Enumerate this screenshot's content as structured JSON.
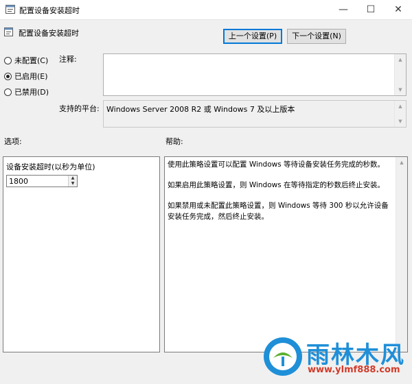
{
  "window": {
    "title": "配置设备安装超时",
    "controls": {
      "minimize": "—",
      "maximize": "☐",
      "close": "✕"
    }
  },
  "policy": {
    "name": "配置设备安装超时",
    "prev_label": "上一个设置(P)",
    "next_label": "下一个设置(N)"
  },
  "state": {
    "options": [
      {
        "label": "未配置(C)",
        "checked": false
      },
      {
        "label": "已启用(E)",
        "checked": true
      },
      {
        "label": "已禁用(D)",
        "checked": false
      }
    ]
  },
  "comment": {
    "label": "注释:",
    "value": ""
  },
  "platform": {
    "label": "支持的平台:",
    "value": "Windows Server 2008 R2 或 Windows 7 及以上版本"
  },
  "options_section": {
    "label": "选项:",
    "timeout_label": "设备安装超时(以秒为单位)",
    "timeout_value": "1800"
  },
  "help_section": {
    "label": "帮助:",
    "paragraphs": [
      "使用此策略设置可以配置 Windows 等待设备安装任务完成的秒数。",
      "如果启用此策略设置，则 Windows 在等待指定的秒数后终止安装。",
      "如果禁用或未配置此策略设置，则 Windows 等待 300 秒以允许设备安装任务完成，然后终止安装。"
    ]
  },
  "watermark": {
    "text": "雨林木风",
    "url": "www.ylmf888.com",
    "color_blue": "#1f8fd8",
    "color_red": "#d23b2a"
  }
}
